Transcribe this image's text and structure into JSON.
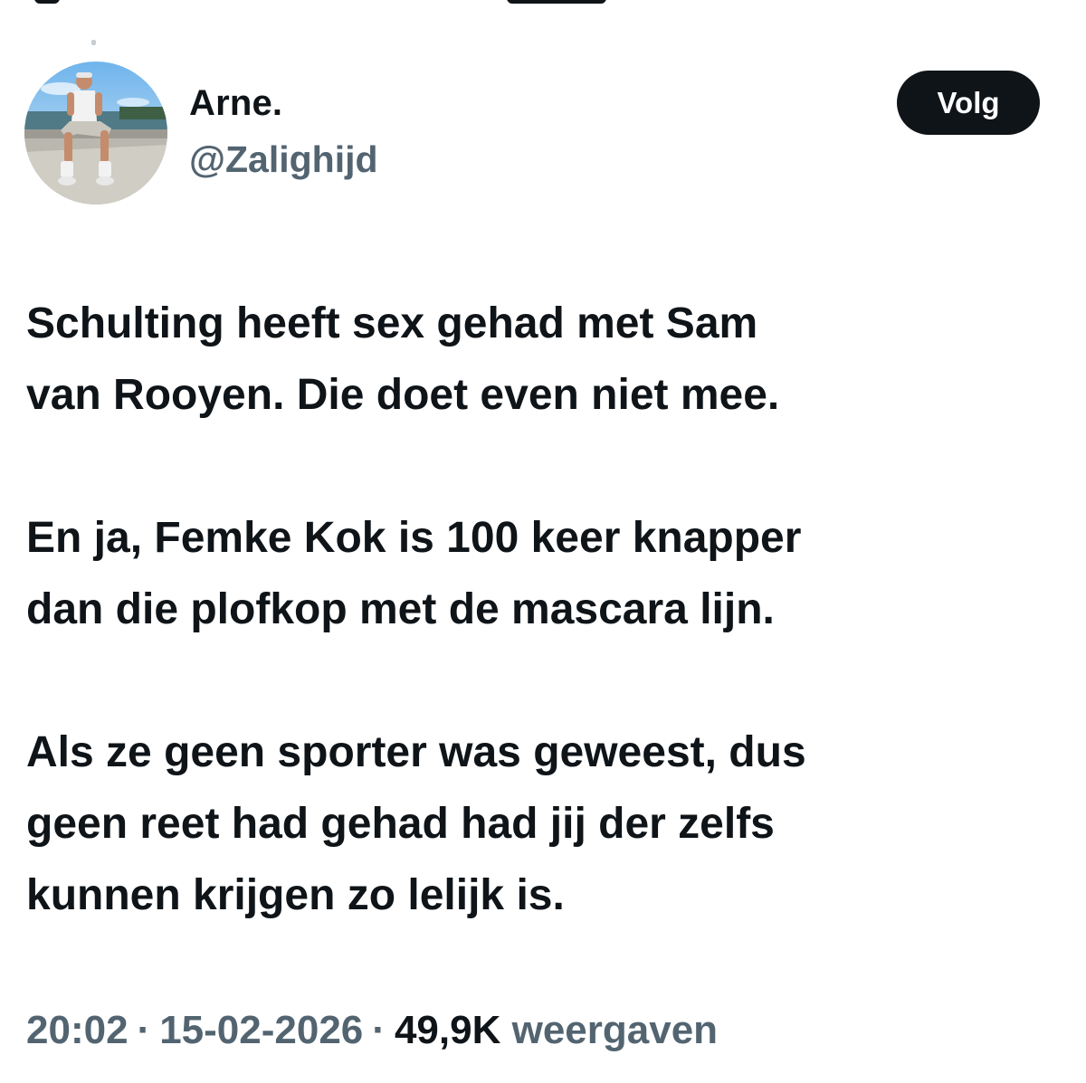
{
  "header": {
    "display_name": "Arne.",
    "handle": "@Zalighijd",
    "follow_label": "Volg"
  },
  "tweet": {
    "paragraphs": [
      "Schulting heeft sex gehad met Sam\nvan Rooyen. Die doet even niet mee.",
      "En ja, Femke Kok is 100 keer knapper\ndan die plofkop met de mascara lijn.",
      "Als ze geen sporter was geweest, dus\ngeen reet had gehad had jij der zelfs\nkunnen krijgen zo lelijk is."
    ]
  },
  "meta": {
    "time": "20:02",
    "separator": "·",
    "date": "15-02-2026",
    "views_count": "49,9K",
    "views_label": "weergaven"
  },
  "colors": {
    "text_primary": "#0f1419",
    "text_secondary": "#536471",
    "button_bg": "#0f1419",
    "button_text": "#ffffff"
  }
}
